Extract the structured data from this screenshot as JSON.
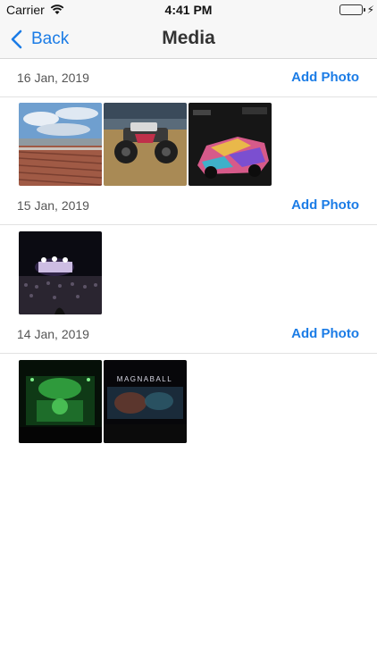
{
  "status_bar": {
    "carrier": "Carrier",
    "time": "4:41 PM"
  },
  "nav": {
    "back_label": "Back",
    "title": "Media"
  },
  "sections": [
    {
      "date": "16 Jan, 2019",
      "add_label": "Add Photo",
      "photo_count": 3
    },
    {
      "date": "15 Jan, 2019",
      "add_label": "Add Photo",
      "photo_count": 1
    },
    {
      "date": "14 Jan, 2019",
      "add_label": "Add Photo",
      "photo_count": 2
    }
  ],
  "photos": [
    {
      "name": "stadium-photo",
      "description": "stadium seating under blue sky"
    },
    {
      "name": "monster-truck-photo",
      "description": "monster truck on dirt arena"
    },
    {
      "name": "painted-sports-car-photo",
      "description": "colorful painted sports car at night"
    },
    {
      "name": "concert-crowd-photo",
      "description": "concert stage with crowd at night"
    },
    {
      "name": "green-stage-photo",
      "description": "green-lit concert stage"
    },
    {
      "name": "magnaball-screen-photo",
      "description": "MAGNABALL concert screen"
    }
  ],
  "colors": {
    "accent": "#1b7ce6",
    "battery": "#4cd964"
  }
}
